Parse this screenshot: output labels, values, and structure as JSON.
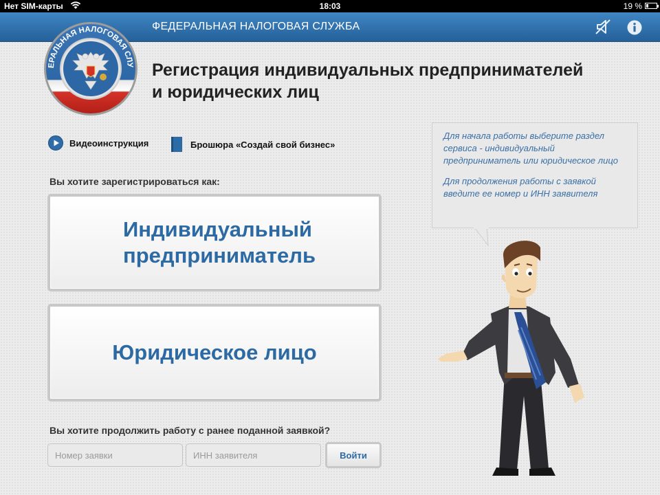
{
  "status_bar": {
    "carrier": "Нет SIM-карты",
    "time": "18:03",
    "battery": "19 %",
    "battery_level": 0.19
  },
  "header": {
    "title": "ФЕДЕРАЛЬНАЯ НАЛОГОВАЯ СЛУЖБА",
    "icons": [
      "mute-icon",
      "info-icon"
    ]
  },
  "emblem": {
    "text": "ФЕДЕРАЛЬНАЯ НАЛОГОВАЯ СЛУЖБА"
  },
  "page": {
    "title_line1": "Регистрация индивидуальных предпринимателей",
    "title_line2": "и юридических лиц"
  },
  "resources": {
    "video_label": "Видеоинструкция",
    "brochure_label": "Брошюра «Создай свой бизнес»"
  },
  "register": {
    "question": "Вы хотите зарегистрироваться как:",
    "ip_line1": "Индивидуальный",
    "ip_line2": "предприниматель",
    "legal_entity": "Юридическое лицо"
  },
  "continue": {
    "question": "Вы хотите продолжить работу с ранее поданной заявкой?",
    "number_placeholder": "Номер заявки",
    "inn_placeholder": "ИНН заявителя",
    "login_label": "Войти"
  },
  "hint": {
    "paragraph1": "Для начала работы выберите раздел сервиса  - индивидуальный предприниматель или юридическое лицо",
    "paragraph2": "Для продолжения работы с заявкой введите ее номер и ИНН заявителя"
  },
  "colors": {
    "header": "#2f73b2",
    "accent_text": "#2d6aa4",
    "hint_text": "#3b6fa5"
  }
}
